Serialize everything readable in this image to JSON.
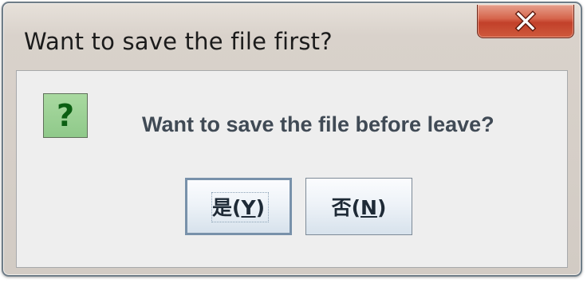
{
  "window": {
    "title": "Want to save the file first?"
  },
  "dialog": {
    "icon": "question-icon",
    "icon_glyph": "?",
    "message": "Want to save the file before leave?"
  },
  "buttons": {
    "yes": {
      "text_main": "是",
      "text_open": "(",
      "mnemonic": "Y",
      "text_close": ")"
    },
    "no": {
      "text_main": "否",
      "text_open": "(",
      "mnemonic": "N",
      "text_close": ")"
    }
  },
  "colors": {
    "close_button": "#c2402a",
    "icon_bg": "#8fc98a",
    "icon_fg": "#0b5f12",
    "message_text": "#404a55",
    "button_border_default": "#7891aa"
  }
}
